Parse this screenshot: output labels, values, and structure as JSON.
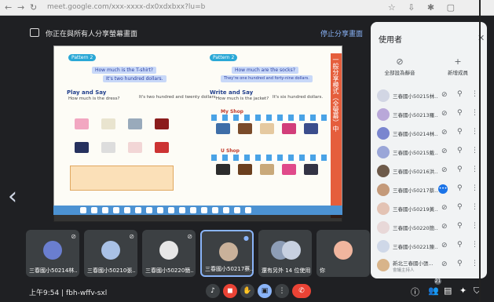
{
  "browser": {
    "url": "meet.google.com/xxx-xxxx-dx0xdxbxx?lu=b",
    "toolbar_icons": "☆ ⇩ ✱ ▢"
  },
  "banner": {
    "message": "你正在與所有人分享螢幕畫面",
    "stop_label": "停止分享畫面",
    "accent": "#8ab4f8"
  },
  "slide": {
    "pattern_left": "Pattern 2",
    "pattern_right": "Pattern 2",
    "q1": "How much is the T-shirt?",
    "a1": "It's two hundred dollars.",
    "q2": "How much are the socks?",
    "a2": "They're one hundred and forty-nine dollars.",
    "play_say": "Play and Say",
    "write_say": "Write and Say",
    "how_much_dress": "How much is the dress?",
    "two_hundred_twenty": "It's two hundred and twenty dollars.",
    "how_much_jacket": "How much is the jacket?",
    "six_hundred": "It's six hundred dollars.",
    "myshop": "My Shop",
    "ushop": "U Shop",
    "side_text": "一般分享模式（全螢幕）中",
    "accent": "#e55e3c"
  },
  "tiles": [
    {
      "name": "三春國小50214林..."
    },
    {
      "name": "三春國小50210張..."
    },
    {
      "name": "三春國小50220簡..."
    },
    {
      "name": "三春國小50217蔡..."
    },
    {
      "name": "還有另外 14 位使用者"
    },
    {
      "name": "你"
    }
  ],
  "bottom": {
    "time": "上午9:54",
    "sep": "|",
    "meeting_code": "fbh-wffv-sxl"
  },
  "panel": {
    "title": "使用者",
    "close": "✕",
    "tab_mute_all": "全部設為靜音",
    "tab_add": "新增成員",
    "people": [
      {
        "name": "三春國小50215林...",
        "sub": ""
      },
      {
        "name": "三春國小50213羅...",
        "sub": ""
      },
      {
        "name": "三春國小50214林...",
        "sub": ""
      },
      {
        "name": "三春國小50215戴...",
        "sub": ""
      },
      {
        "name": "三春國小50216洪...",
        "sub": ""
      },
      {
        "name": "三春國小50217蔡...",
        "sub": ""
      },
      {
        "name": "三春國小50219黃...",
        "sub": ""
      },
      {
        "name": "三春國小50220簡...",
        "sub": ""
      },
      {
        "name": "三春國小50221陳...",
        "sub": ""
      },
      {
        "name": "新北三春國小張...",
        "sub": "會議主持人"
      }
    ],
    "badge": "21"
  },
  "colors": {
    "meet_bg": "#1f2023",
    "tile_bg": "#3c4043",
    "panel_bg": "#f1f3f4",
    "end_call": "#ea4335"
  }
}
